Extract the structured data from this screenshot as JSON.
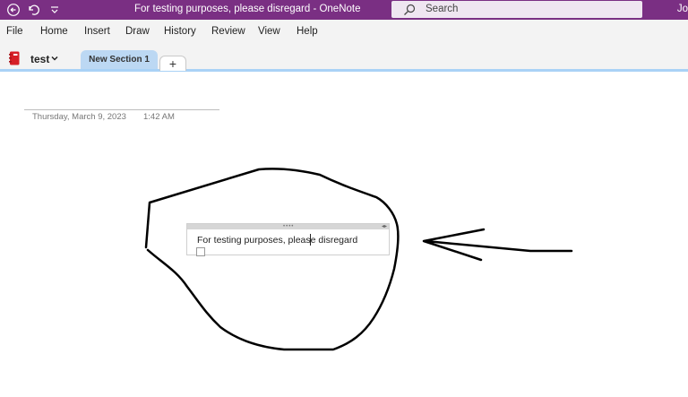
{
  "window": {
    "title": "For testing purposes, please disregard  -  OneNote",
    "search_placeholder": "Search",
    "user_initials": "Jo"
  },
  "menu": {
    "items": [
      "File",
      "Home",
      "Insert",
      "Draw",
      "History",
      "Review",
      "View",
      "Help"
    ]
  },
  "notebook": {
    "name": "test",
    "section_tab": "New Section 1",
    "add_tab": "+"
  },
  "page": {
    "date": "Thursday, March 9, 2023",
    "time": "1:42 AM",
    "note_text": "For testing purposes, please disregard"
  },
  "colors": {
    "titlebar": "#7a2f83",
    "section_tab": "#bcd8f3",
    "tab_underline": "#a9d2f6",
    "ink": "#000000",
    "notebook_icon": "#d61f26"
  }
}
